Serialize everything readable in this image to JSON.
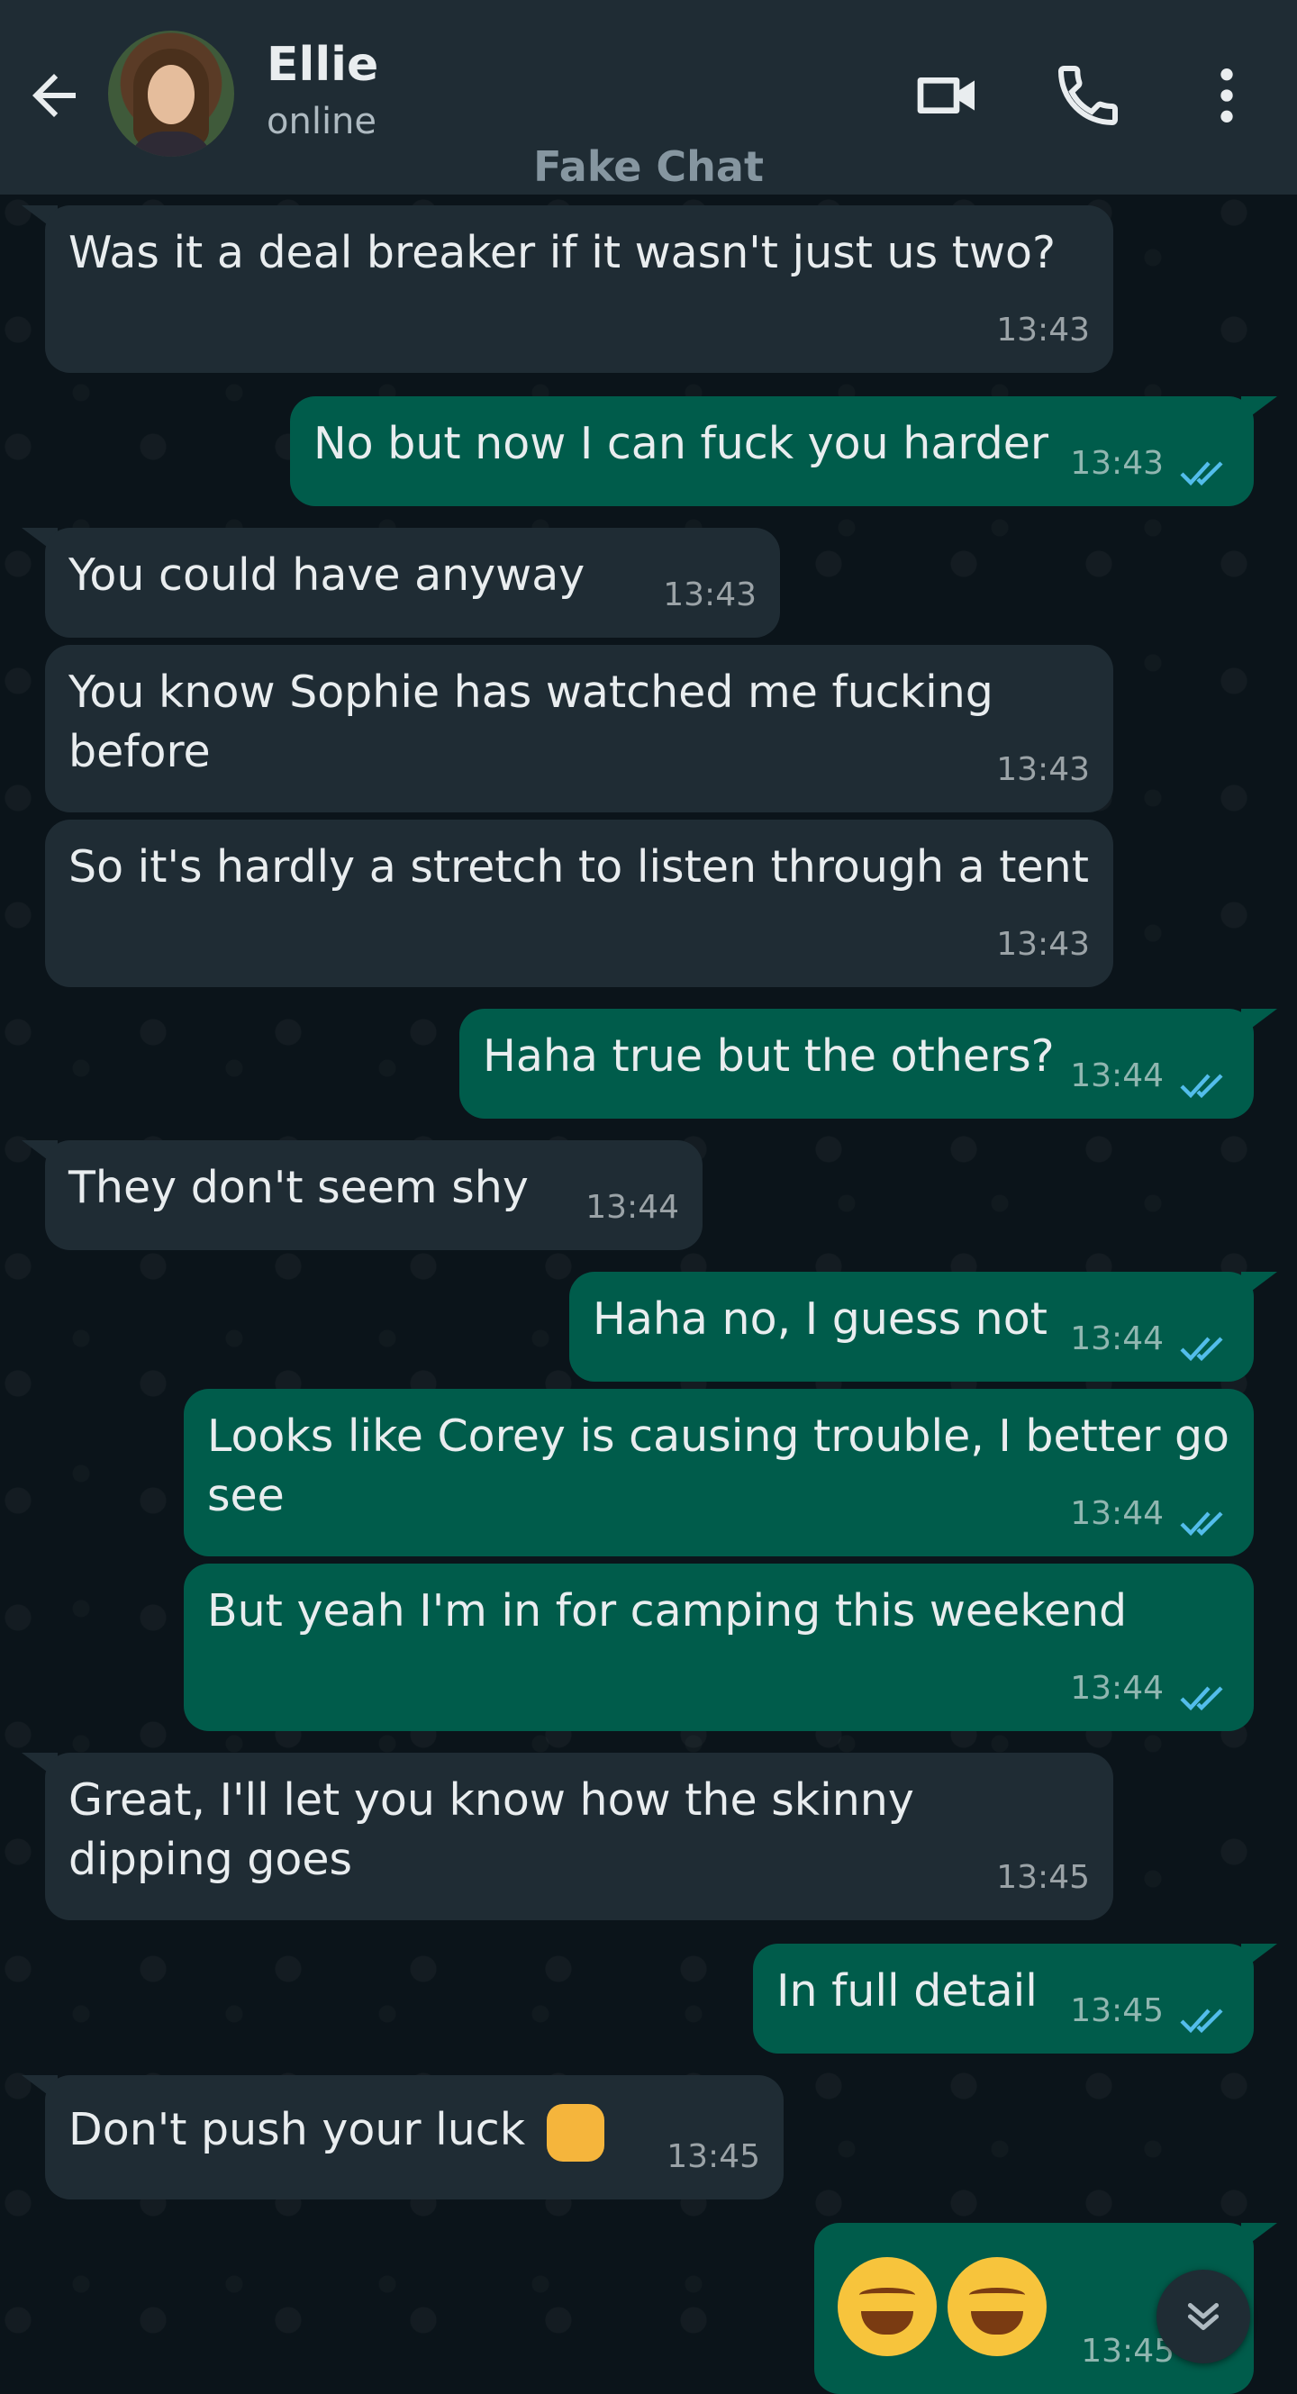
{
  "header": {
    "contact_name": "Ellie",
    "status": "online",
    "app_label": "Fake Chat",
    "icons": [
      "back-arrow-icon",
      "video-call-icon",
      "phone-icon",
      "more-options-icon"
    ]
  },
  "colors": {
    "header_bg": "#1f2c34",
    "chat_bg": "#0b141a",
    "incoming_bubble": "#1f2c34",
    "outgoing_bubble": "#005c4b",
    "read_ticks": "#53bdeb"
  },
  "messages": [
    {
      "dir": "in",
      "text": "Was it a deal breaker if it wasn't just us two?",
      "time": "13:43"
    },
    {
      "dir": "out",
      "text": "No but now I can fuck you harder",
      "time": "13:43"
    },
    {
      "dir": "in",
      "text": "You could have anyway",
      "time": "13:43"
    },
    {
      "dir": "in",
      "text": "You know Sophie has watched me fucking before",
      "time": "13:43"
    },
    {
      "dir": "in",
      "text": "So it's hardly a stretch to listen through a tent",
      "time": "13:43"
    },
    {
      "dir": "out",
      "text": "Haha true but the others?",
      "time": "13:44"
    },
    {
      "dir": "in",
      "text": "They don't seem shy",
      "time": "13:44"
    },
    {
      "dir": "out",
      "text": "Haha no, I guess not",
      "time": "13:44"
    },
    {
      "dir": "out",
      "text": "Looks like Corey is causing trouble, I better go see",
      "time": "13:44"
    },
    {
      "dir": "out",
      "text": "But yeah I'm in for camping this weekend",
      "time": "13:44"
    },
    {
      "dir": "in",
      "text": "Great, I'll let you know how the skinny dipping goes",
      "time": "13:45"
    },
    {
      "dir": "out",
      "text": "In full detail",
      "time": "13:45"
    },
    {
      "dir": "in",
      "text": "Don't push your luck",
      "emoji": "oncoming-fist-emoji",
      "time": "13:45"
    },
    {
      "dir": "out",
      "text": "",
      "emoji": "rolling-on-floor-laughing-emoji x2",
      "time": "13:45"
    }
  ],
  "scroll_button": {
    "icon": "double-chevron-down-icon"
  }
}
